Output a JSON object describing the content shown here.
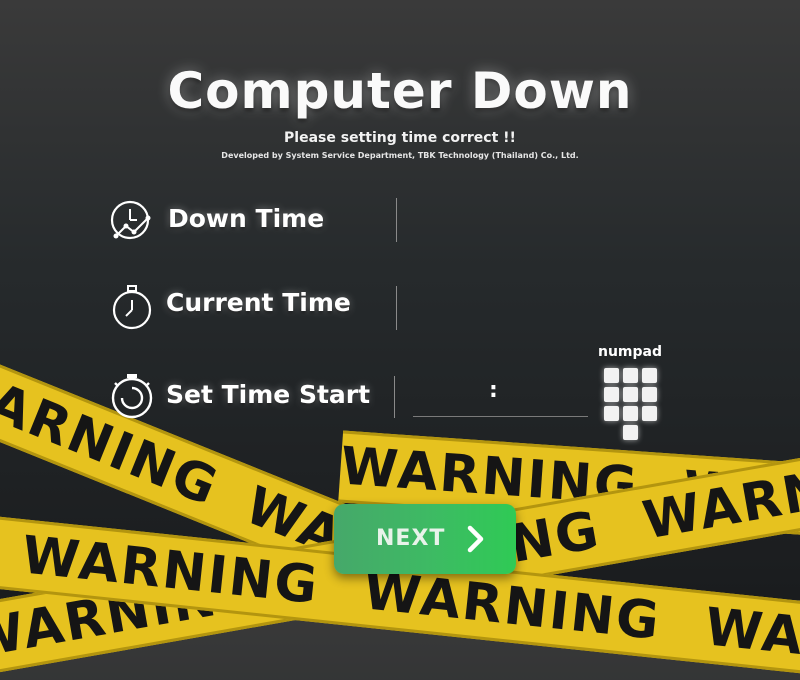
{
  "header": {
    "title": "Computer Down",
    "subtitle": "Please setting time correct !!",
    "credit": "Developed by System Service Department, TBK Technology (Thailand) Co., Ltd."
  },
  "rows": [
    {
      "label": "Down Time",
      "icon": "clock-chart-icon"
    },
    {
      "label": "Current Time",
      "icon": "stopwatch-icon"
    },
    {
      "label": "Set Time Start",
      "icon": "timer-start-icon"
    }
  ],
  "set_time": {
    "separator": ":",
    "hours": "",
    "minutes": ""
  },
  "numpad": {
    "label": "numpad",
    "icon": "numpad-grid-icon"
  },
  "next_button": {
    "label": "NEXT",
    "icon": "chevron-right-icon"
  },
  "background": {
    "tape_text": "WARNING",
    "tape_color": "#e6c21f"
  },
  "colors": {
    "accent": "#3dbb63",
    "text": "#ffffff"
  }
}
